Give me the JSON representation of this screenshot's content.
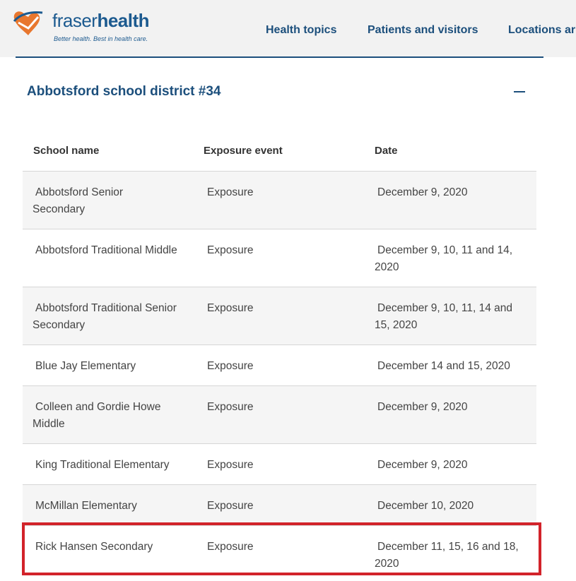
{
  "header": {
    "brand_light": "fraser",
    "brand_bold": "health",
    "tagline": "Better health. Best in health care.",
    "nav": [
      "Health topics",
      "Patients and visitors",
      "Locations ar"
    ]
  },
  "section": {
    "title": "Abbotsford school district #34",
    "toggle_icon": "minus-icon"
  },
  "table": {
    "columns": [
      "School name",
      "Exposure event",
      "Date"
    ],
    "rows": [
      {
        "school": [
          "Abbotsford Senior",
          "Secondary"
        ],
        "event": "Exposure",
        "date": [
          "December 9, 2020"
        ]
      },
      {
        "school": [
          "Abbotsford Traditional Middle"
        ],
        "event": "Exposure",
        "date": [
          "December 9, 10, 11 and 14,",
          "2020"
        ]
      },
      {
        "school": [
          "Abbotsford Traditional Senior",
          "Secondary"
        ],
        "event": "Exposure",
        "date": [
          "December 9, 10, 11, 14 and",
          "15, 2020"
        ]
      },
      {
        "school": [
          "Blue Jay Elementary"
        ],
        "event": "Exposure",
        "date": [
          "December 14 and 15, 2020"
        ]
      },
      {
        "school": [
          "Colleen and Gordie Howe",
          "Middle"
        ],
        "event": "Exposure",
        "date": [
          "December 9, 2020"
        ]
      },
      {
        "school": [
          "King Traditional Elementary"
        ],
        "event": "Exposure",
        "date": [
          "December 9, 2020"
        ]
      },
      {
        "school": [
          "McMillan Elementary"
        ],
        "event": "Exposure",
        "date": [
          "December 10, 2020"
        ]
      },
      {
        "school": [
          "Rick Hansen Secondary"
        ],
        "event": "Exposure",
        "date": [
          "December 11, 15, 16 and 18,",
          "2020"
        ]
      }
    ]
  },
  "colors": {
    "brand_blue": "#1c4f7c",
    "logo_orange": "#e8772e",
    "highlight_red": "#d2232a"
  }
}
